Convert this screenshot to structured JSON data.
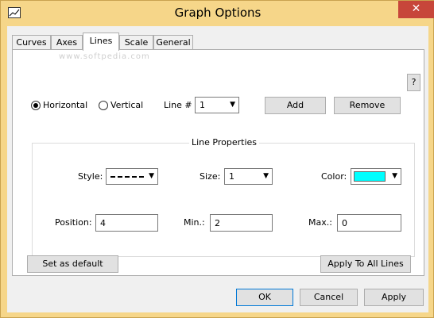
{
  "window": {
    "title": "Graph Options",
    "close_glyph": "✕"
  },
  "tabs": [
    {
      "label": "Curves"
    },
    {
      "label": "Axes"
    },
    {
      "label": "Lines",
      "active": true
    },
    {
      "label": "Scale"
    },
    {
      "label": "General"
    }
  ],
  "watermark": "www.softpedia.com",
  "help_label": "?",
  "orientation": {
    "horizontal_label": "Horizontal",
    "vertical_label": "Vertical",
    "selected": "horizontal"
  },
  "line_selector": {
    "label": "Line #",
    "value": "1"
  },
  "buttons": {
    "add": "Add",
    "remove": "Remove",
    "set_default": "Set as default",
    "apply_all": "Apply To All Lines",
    "ok": "OK",
    "cancel": "Cancel",
    "apply": "Apply"
  },
  "line_properties": {
    "title": "Line Properties",
    "style_label": "Style:",
    "size_label": "Size:",
    "size_value": "1",
    "color_label": "Color:",
    "color_value": "#00ffff",
    "position_label": "Position:",
    "position_value": "4",
    "min_label": "Min.:",
    "min_value": "2",
    "max_label": "Max.:",
    "max_value": "0"
  },
  "icons": {
    "dropdown": "chevron-down-icon"
  }
}
